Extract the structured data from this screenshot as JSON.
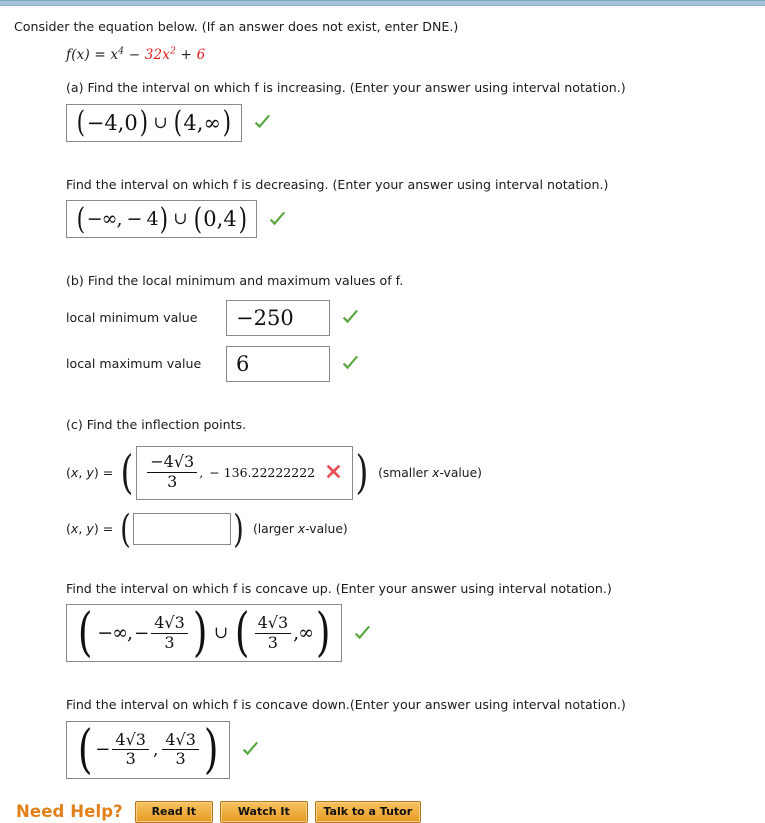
{
  "theme": {
    "topbar_color": "#a6c2db",
    "correct_color": "#5aa741",
    "incorrect_color": "#e8505a",
    "accent_color": "#e2801a",
    "equation_highlight_color": "#e01b1b"
  },
  "intro": {
    "text": "Consider the equation below. (If an answer does not exist, enter DNE.)"
  },
  "equation": {
    "lhs": "f(x) = ",
    "term1": "x",
    "term1_exp": "4",
    "operator1": " − ",
    "term2": "32x",
    "term2_exp": "2",
    "operator2": " + ",
    "term3": "6",
    "plain": "f(x) = x^4 - 32x^2 + 6"
  },
  "parts": {
    "a": {
      "label": "(a) Find the interval on which f is increasing. (Enter your answer using interval notation.)",
      "answer_plain": "(-4,0) U (4,infinity)",
      "answer_tokens": {
        "a1": "−4,0",
        "a2": "4,∞"
      },
      "status": "correct"
    },
    "a2": {
      "label": "Find the interval on which f is decreasing. (Enter your answer using interval notation.)",
      "answer_plain": "(-infinity, -4) U (0,4)",
      "answer_tokens": {
        "a1": "−∞, − 4",
        "a2": "0,4"
      },
      "status": "correct"
    },
    "b": {
      "label": "(b) Find the local minimum and maximum values of f.",
      "min_label": "local minimum value",
      "min_value": "−250",
      "min_status": "correct",
      "max_label": "local maximum value",
      "max_value": "6",
      "max_status": "correct"
    },
    "c": {
      "label": "(c) Find the inflection points.",
      "point1": {
        "prefix": "(x, y) = ",
        "x_numerator": "−4√3",
        "x_denominator": "3",
        "separator": ",",
        "y_value": "− 136.22222222",
        "status": "incorrect",
        "note": "(smaller x-value)"
      },
      "point2": {
        "prefix": "(x, y) = ",
        "value": "",
        "status": "empty",
        "note": "(larger x-value)"
      }
    },
    "concave_up": {
      "label": "Find the interval on which f is concave up. (Enter your answer using interval notation.)",
      "answer_plain": "(-infinity, -4sqrt(3)/3) U (4sqrt(3)/3, infinity)",
      "status": "correct",
      "frac_numerator": "4√3",
      "frac_denominator": "3"
    },
    "concave_down": {
      "label": "Find the interval on which f is concave down.(Enter your answer using interval notation.)",
      "answer_plain": "(-4sqrt(3)/3, 4sqrt(3)/3)",
      "status": "correct",
      "frac_numerator": "4√3",
      "frac_denominator": "3"
    }
  },
  "need_help": {
    "label": "Need Help?",
    "buttons": [
      {
        "label": "Read It"
      },
      {
        "label": "Watch It"
      },
      {
        "label": "Talk to a Tutor"
      }
    ]
  }
}
